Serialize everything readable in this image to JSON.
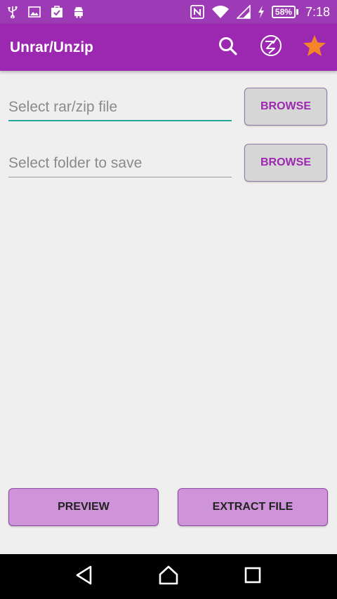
{
  "status_bar": {
    "icons": [
      "usb-icon",
      "image-icon",
      "clipboard-check-icon",
      "android-icon",
      "nfc-icon",
      "wifi-icon",
      "signal-icon",
      "charging-icon"
    ],
    "battery": "58%",
    "time": "7:18"
  },
  "appbar": {
    "title": "Unrar/Unzip",
    "actions": [
      "search-icon",
      "no-ads-icon",
      "star-icon"
    ],
    "accent_color": "#9c27b0",
    "star_color": "#f4842a"
  },
  "source": {
    "placeholder": "Select rar/zip file",
    "value": "",
    "browse_label": "BROWSE"
  },
  "destination": {
    "placeholder": "Select folder to save",
    "value": "",
    "browse_label": "BROWSE"
  },
  "footer": {
    "preview_label": "PREVIEW",
    "extract_label": "EXTRACT FILE",
    "button_color": "#ce93d8"
  },
  "navbar": {
    "icons": [
      "back-icon",
      "home-icon",
      "recents-icon"
    ]
  }
}
